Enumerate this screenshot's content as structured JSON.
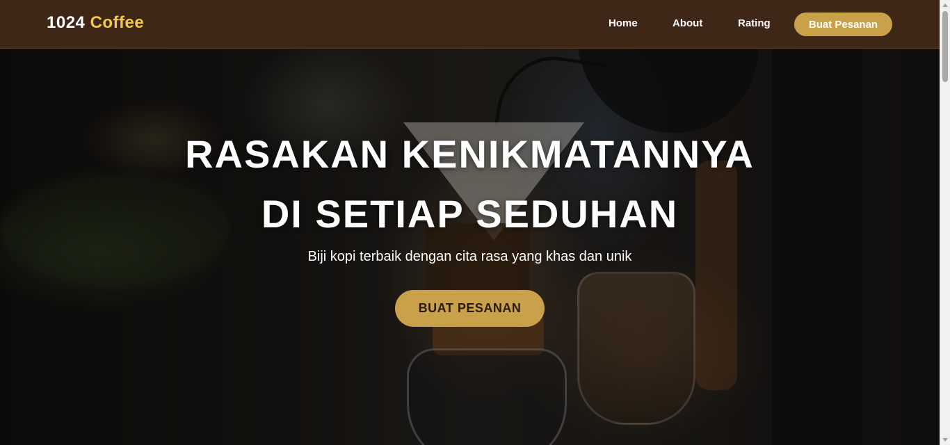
{
  "brand": {
    "name": "1024",
    "accent": "Coffee"
  },
  "nav": {
    "links": [
      {
        "label": "Home"
      },
      {
        "label": "About"
      },
      {
        "label": "Rating"
      }
    ],
    "cta_label": "Buat Pesanan"
  },
  "hero": {
    "title_line1": "RASAKAN KENIKMATANNYA",
    "title_line2": "DI SETIAP SEDUHAN",
    "subtitle": "Biji kopi terbaik dengan cita rasa yang khas dan unik",
    "cta_label": "BUAT PESANAN",
    "background_image": "coffee-pour-over-brewing"
  },
  "colors": {
    "navbar_bg": "#3e2716",
    "brand_accent": "#f2c94c",
    "button_gold": "#c9a14a"
  }
}
